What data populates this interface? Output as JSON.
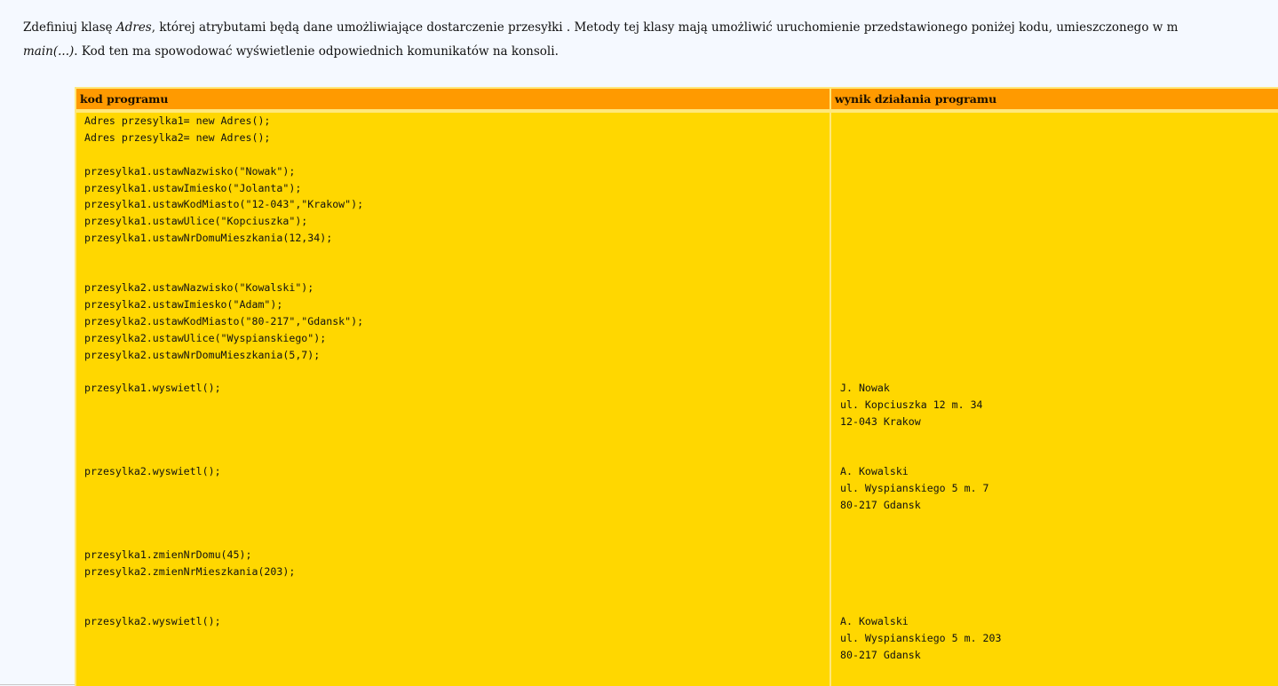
{
  "intro": {
    "line1_a": "Zdefiniuj klasę ",
    "line1_em": "Adres",
    "line1_b": ", której atrybutami będą dane umożliwiające dostarczenie przesyłki . Metody tej klasy mają umożliwić uruchomienie przedstawionego poniżej kodu, umieszczonego w m",
    "line2_em": "main(...)",
    "line2_b": ". Kod ten ma spowodować wyświetlenie odpowiednich komunikatów na konsoli."
  },
  "table": {
    "headers": {
      "code": "kod programu",
      "result": "wynik działania programu"
    },
    "code_lines": [
      "Adres przesylka1= new Adres();",
      "Adres przesylka2= new Adres();",
      "przesylka1.ustawNazwisko(\"Nowak\");",
      "przesylka1.ustawImiesko(\"Jolanta\");",
      "przesylka1.ustawKodMiasto(\"12-043\",\"Krakow\");",
      "przesylka1.ustawUlice(\"Kopciuszka\");",
      "przesylka1.ustawNrDomuMieszkania(12,34);",
      "przesylka2.ustawNazwisko(\"Kowalski\");",
      "przesylka2.ustawImiesko(\"Adam\");",
      "przesylka2.ustawKodMiasto(\"80-217\",\"Gdansk\");",
      "przesylka2.ustawUlice(\"Wyspianskiego\");",
      "przesylka2.ustawNrDomuMieszkania(5,7);",
      "przesylka1.wyswietl();",
      "przesylka2.wyswietl();",
      "przesylka1.zmienNrDomu(45);",
      "przesylka2.zmienNrMieszkania(203);",
      "przesylka2.wyswietl();"
    ],
    "output_lines": [
      "J. Nowak",
      "ul. Kopciuszka 12 m. 34",
      "12-043 Krakow",
      "A. Kowalski",
      "ul. Wyspianskiego 5 m. 7",
      "80-217 Gdansk",
      "A. Kowalski",
      "ul. Wyspianskiego 5 m. 203",
      "80-217 Gdansk"
    ]
  }
}
